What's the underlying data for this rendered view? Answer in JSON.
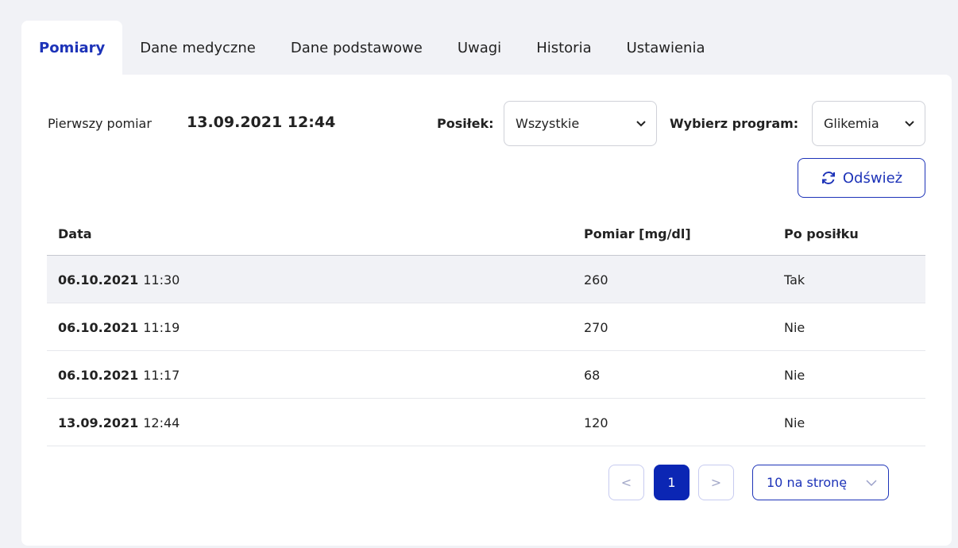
{
  "tabs": [
    {
      "label": "Pomiary",
      "active": true
    },
    {
      "label": "Dane medyczne"
    },
    {
      "label": "Dane podstawowe"
    },
    {
      "label": "Uwagi"
    },
    {
      "label": "Historia"
    },
    {
      "label": "Ustawienia"
    }
  ],
  "filters": {
    "first_measurement_label": "Pierwszy pomiar",
    "first_measurement_value": "13.09.2021 12:44",
    "meal_label": "Posiłek:",
    "meal_value": "Wszystkie",
    "program_label": "Wybierz program:",
    "program_value": "Glikemia",
    "refresh_label": "Odśwież"
  },
  "table": {
    "headers": [
      "Data",
      "Pomiar [mg/dl]",
      "Po posiłku"
    ],
    "rows": [
      {
        "date": "06.10.2021",
        "time": "11:30",
        "value": "260",
        "after_meal": "Tak"
      },
      {
        "date": "06.10.2021",
        "time": "11:19",
        "value": "270",
        "after_meal": "Nie"
      },
      {
        "date": "06.10.2021",
        "time": "11:17",
        "value": "68",
        "after_meal": "Nie"
      },
      {
        "date": "13.09.2021",
        "time": "12:44",
        "value": "120",
        "after_meal": "Nie"
      }
    ]
  },
  "pagination": {
    "prev": "<",
    "current_page": "1",
    "next": ">",
    "per_page": "10 na stronę"
  },
  "colors": {
    "accent": "#1d33b8",
    "active_page": "#0b26b4",
    "background": "#f1f2f6"
  },
  "icons": {
    "refresh": "refresh-icon",
    "dropdown": "chevron-down-icon"
  }
}
